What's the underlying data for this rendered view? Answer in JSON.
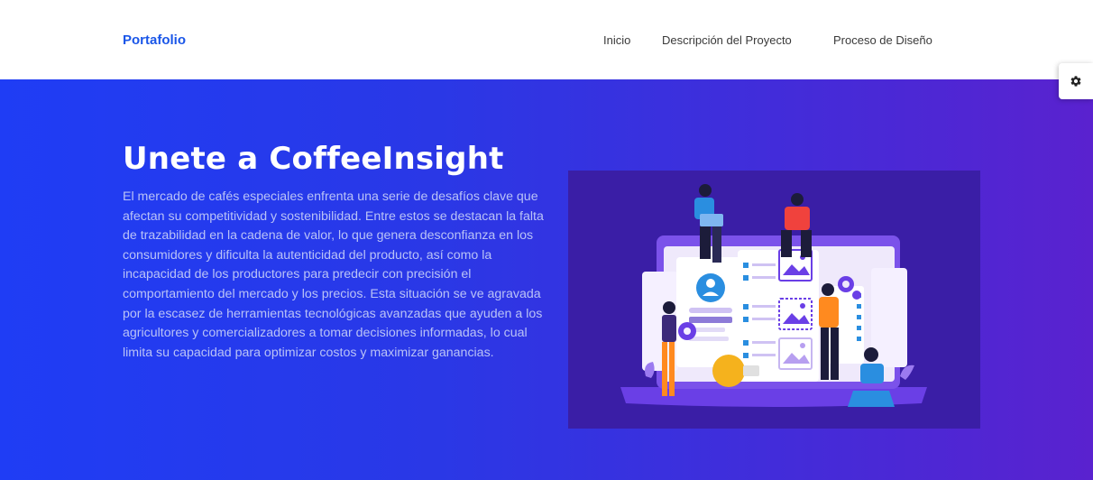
{
  "nav": {
    "brand": "Portafolio",
    "links": [
      {
        "label": "Inicio"
      },
      {
        "label": "Descripción del Proyecto"
      },
      {
        "label": "Proceso de Diseño"
      }
    ]
  },
  "settings": {
    "icon": "gear-icon"
  },
  "hero": {
    "title": "Unete a CoffeeInsight",
    "description": "El mercado de cafés especiales enfrenta una serie de desafíos clave que afectan su competitividad y sostenibilidad. Entre estos se destacan la falta de trazabilidad en la cadena de valor, lo que genera desconfianza en los consumidores y dificulta la autenticidad del producto, así como la incapacidad de los productores para predecir con precisión el comportamiento del mercado y los precios. Esta situación se ve agravada por la escasez de herramientas tecnológicas avanzadas que ayuden a los agricultores y comercializadores a tomar decisiones informadas, lo cual limita su capacidad para optimizar costos y maximizar ganancias."
  },
  "colors": {
    "brand": "#1a56e8",
    "hero_gradient_start": "#1f3df5",
    "hero_gradient_end": "#5a22cf",
    "illustration_bg": "#3a1ea6"
  }
}
